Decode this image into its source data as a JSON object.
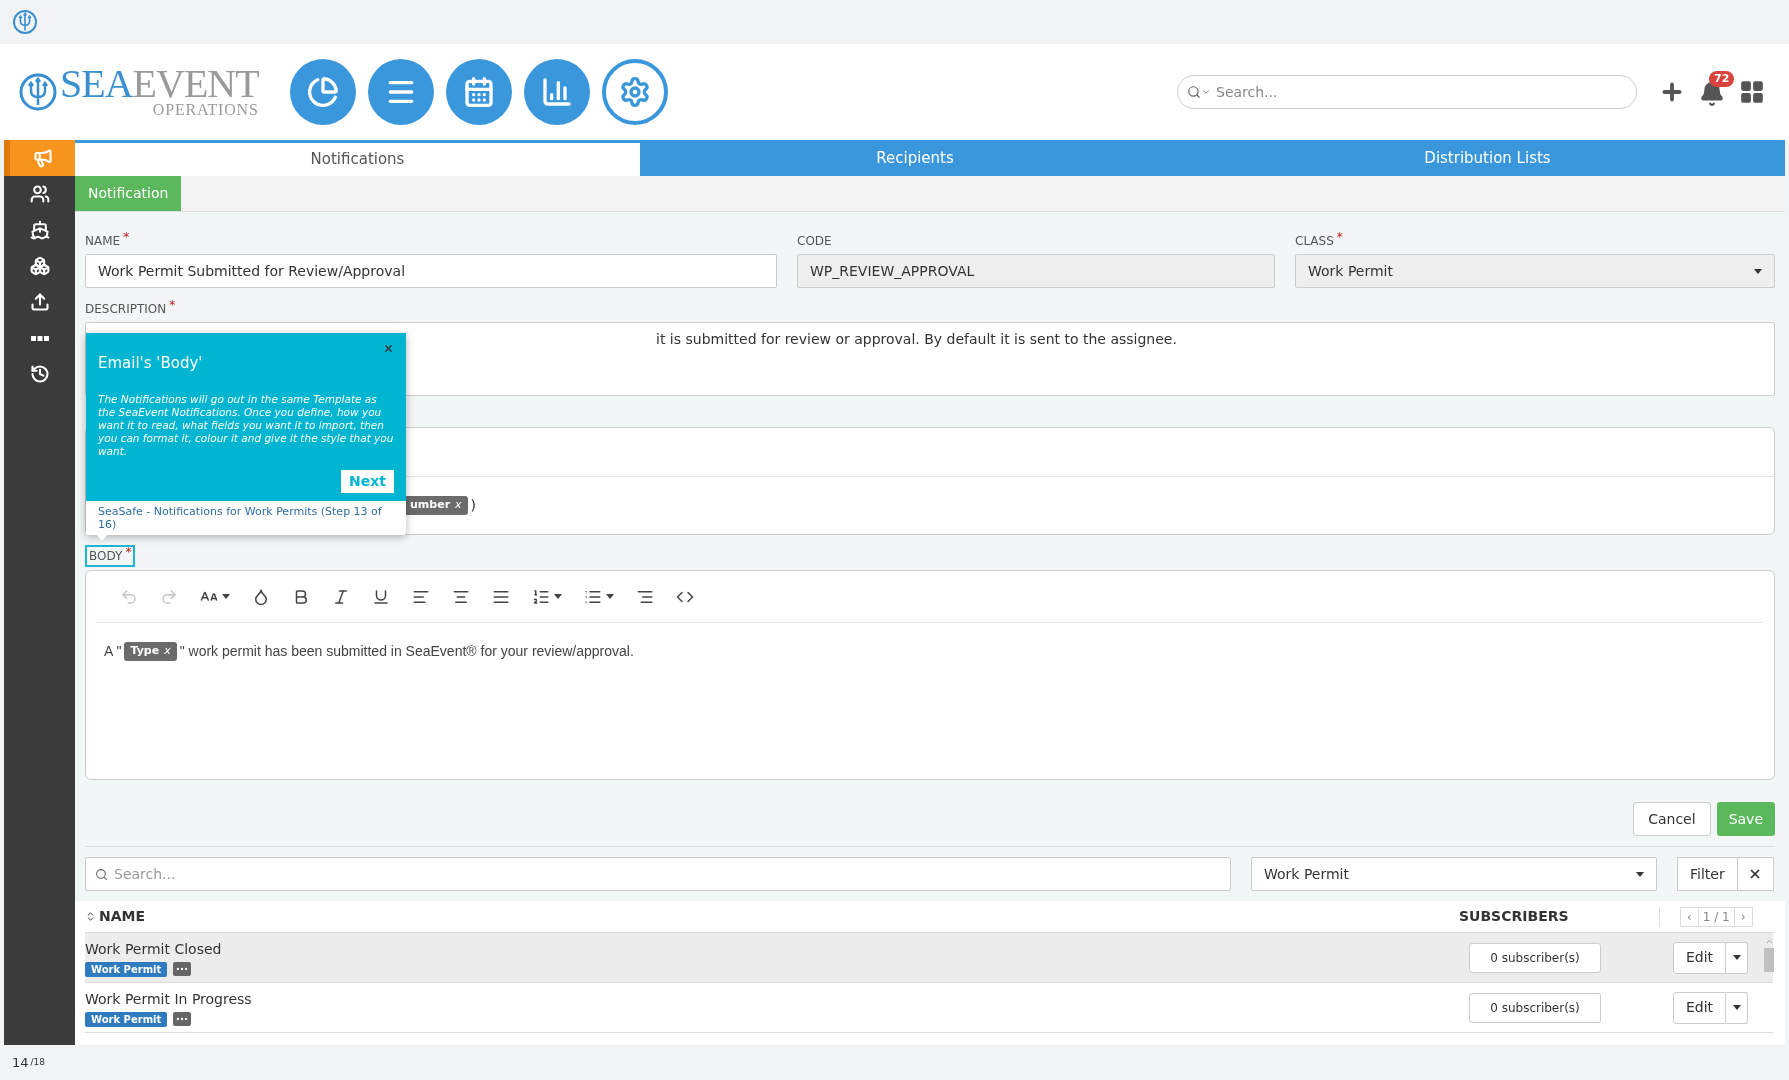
{
  "logo": {
    "primary": "SEA",
    "secondary": "EVENT",
    "subtitle": "OPERATIONS"
  },
  "nav_buttons": [
    {
      "selected": false
    },
    {
      "selected": false
    },
    {
      "selected": false
    },
    {
      "selected": false
    },
    {
      "selected": true
    }
  ],
  "search": {
    "placeholder": "Search..."
  },
  "notifications": {
    "count": "72"
  },
  "sidebar": [
    {
      "selected": true
    },
    {
      "selected": false
    },
    {
      "selected": false
    },
    {
      "selected": false
    },
    {
      "selected": false
    },
    {
      "selected": false
    },
    {
      "selected": false
    }
  ],
  "tabs": [
    {
      "label": "Notifications",
      "selected": true
    },
    {
      "label": "Recipients",
      "selected": false
    },
    {
      "label": "Distribution Lists",
      "selected": false
    }
  ],
  "subtab": {
    "label": "Notification"
  },
  "fields": {
    "required_marker": "*",
    "name": {
      "label": "NAME",
      "required": true,
      "value": "Work Permit Submitted for Review/Approval"
    },
    "code": {
      "label": "CODE",
      "value": "WP_REVIEW_APPROVAL"
    },
    "class": {
      "label": "CLASS",
      "required": true,
      "value": "Work Permit"
    },
    "description": {
      "label": "DESCRIPTION",
      "required": true,
      "value": "it is submitted for review or approval. By default it is sent to the assignee."
    },
    "subject": {
      "chip": "umber",
      "chip_close": "x",
      "after": ")"
    },
    "body": {
      "label": "BODY",
      "required": true,
      "before": "A \"",
      "chip": "Type",
      "chip_close": "x",
      "after": "\" work permit has been submitted in SeaEvent® for your review/approval."
    }
  },
  "toolbar": [
    {
      "disabled": true,
      "dropdown": false
    },
    {
      "disabled": true,
      "dropdown": false
    },
    {
      "disabled": false,
      "dropdown": true
    },
    {
      "disabled": false,
      "dropdown": false
    },
    {
      "disabled": false,
      "dropdown": false
    },
    {
      "disabled": false,
      "dropdown": false
    },
    {
      "disabled": false,
      "dropdown": false
    },
    {
      "disabled": false,
      "dropdown": false
    },
    {
      "disabled": false,
      "dropdown": false
    },
    {
      "disabled": false,
      "dropdown": false
    },
    {
      "disabled": false,
      "dropdown": true
    },
    {
      "disabled": false,
      "dropdown": true
    },
    {
      "disabled": false,
      "dropdown": false
    },
    {
      "disabled": false,
      "dropdown": false
    }
  ],
  "popover": {
    "title": "Email's 'Body'",
    "text": "The Notifications will go out in the same Template as the SeaEvent Notifications. Once you define, how you want it to read, what fields you want it to import, then you can format it, colour it and give it the style that you want.",
    "next": "Next",
    "footer": "SeaSafe - Notifications for Work Permits (Step 13 of 16)"
  },
  "actions": {
    "cancel": "Cancel",
    "save": "Save"
  },
  "list_filter": {
    "placeholder": "Search...",
    "class": "Work Permit",
    "filter": "Filter"
  },
  "table": {
    "columns": [
      "NAME",
      "SUBSCRIBERS"
    ],
    "pager": {
      "prev": "‹",
      "page": "1 / 1",
      "next": "›"
    },
    "rows": [
      {
        "name": "Work Permit Closed",
        "tag": "Work Permit",
        "subscribers": "0 subscriber(s)",
        "edit": "Edit",
        "selected": true
      },
      {
        "name": "Work Permit In Progress",
        "tag": "Work Permit",
        "subscribers": "0 subscriber(s)",
        "edit": "Edit",
        "selected": false
      }
    ]
  },
  "footer": {
    "page": "14",
    "total": "/18"
  }
}
